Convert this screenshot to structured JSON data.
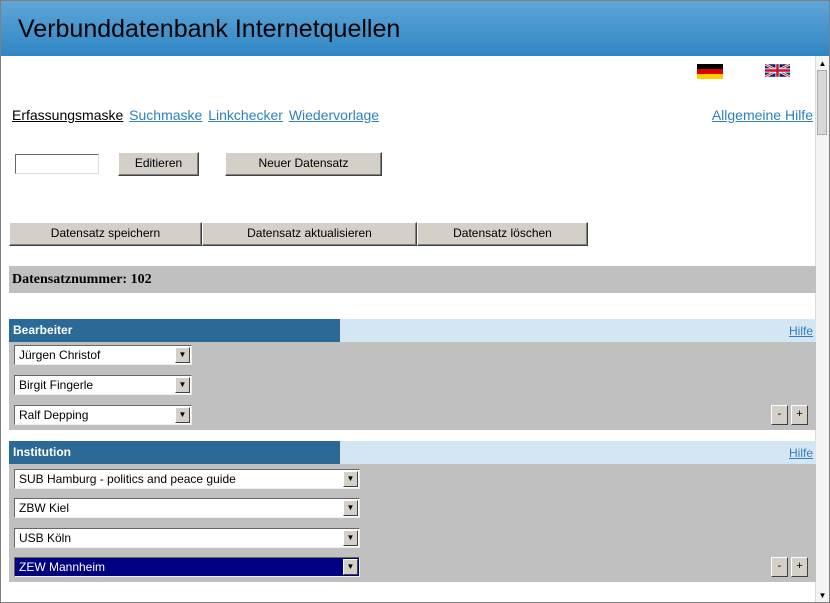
{
  "window": {
    "title": "Verbunddatenbank Internetquellen"
  },
  "nav": {
    "current": "Erfassungsmaske",
    "links": [
      "Suchmaske",
      "Linkchecker",
      "Wiedervorlage"
    ],
    "help": "Allgemeine Hilfe"
  },
  "toolbar": {
    "id_input_value": "",
    "edit_label": "Editieren",
    "new_label": "Neuer Datensatz",
    "save_label": "Datensatz speichern",
    "update_label": "Datensatz aktualisieren",
    "delete_label": "Datensatz löschen"
  },
  "record": {
    "number_text": "Datensatznummer: 102"
  },
  "sections": {
    "bearbeiter": {
      "title": "Bearbeiter",
      "help": "Hilfe",
      "entries": [
        "Jürgen Christof",
        "Birgit Fingerle",
        "Ralf Depping"
      ]
    },
    "institution": {
      "title": "Institution",
      "help": "Hilfe",
      "entries": [
        "SUB Hamburg - politics and peace guide",
        "ZBW Kiel",
        "USB Köln",
        "ZEW Mannheim"
      ]
    }
  },
  "row_buttons": {
    "minus": "-",
    "plus": "+"
  },
  "colors": {
    "title_bar": "#2f86c4",
    "section_header": "#2b6a97",
    "section_header_light": "#d4e6f2",
    "body_gray": "#c0c0c0",
    "link": "#2f7fbf"
  },
  "icons": {
    "flag_de": "german-flag-icon",
    "flag_uk": "uk-flag-icon"
  }
}
